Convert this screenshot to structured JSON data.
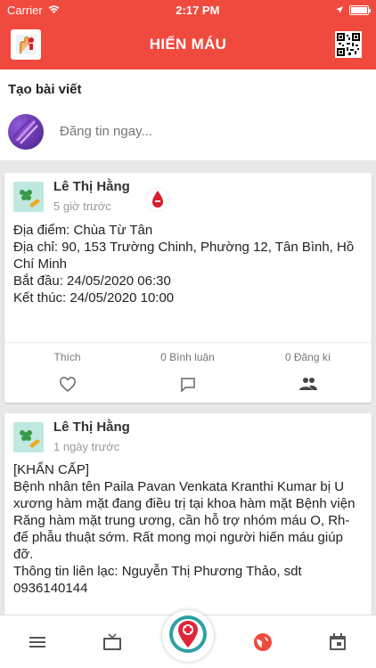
{
  "status_bar": {
    "carrier": "Carrier",
    "time": "2:17 PM"
  },
  "nav": {
    "title": "HIẾN MÁU",
    "left_icon": "blood-donor-icon",
    "right_icon": "qr-code-icon"
  },
  "create_post": {
    "title": "Tạo bài viết",
    "placeholder": "Đăng tin ngay..."
  },
  "posts": [
    {
      "author": "Lê Thị Hằng",
      "time": "5 giờ trước",
      "lines": [
        "Địa điểm: Chùa Từ Tân",
        "Địa chỉ: 90, 153 Trường Chinh, Phường 12, Tân Bình, Hồ Chí Minh",
        "Bắt đầu: 24/05/2020 06:30",
        "Kết thúc: 24/05/2020 10:00"
      ],
      "actions": {
        "like": "Thích",
        "comments": "0 Bình luận",
        "register": "0 Đăng kí"
      }
    },
    {
      "author": "Lê Thị Hằng",
      "time": "1 ngày trước",
      "lines": [
        "[KHẨN CẤP]",
        "Bệnh nhân tên Paila Pavan Venkata Kranthi Kumar bị U xương hàm mặt đang điều trị tại khoa hàm mặt Bệnh viện Răng hàm mặt trung ương, cần hỗ trợ nhóm máu O, Rh- để phẫu thuật sớm. Rất mong mọi người hiến máu giúp đỡ.",
        "Thông tin liên lạc: Nguyễn Thị Phương Thảo, sdt 0936140144"
      ]
    }
  ],
  "tabs": [
    {
      "icon": "menu-icon"
    },
    {
      "icon": "tv-icon"
    },
    {
      "icon": "blood-location-icon"
    },
    {
      "icon": "globe-icon",
      "active": true
    },
    {
      "icon": "calendar-icon"
    }
  ],
  "colors": {
    "brand": "#f04a3e",
    "blood": "#d8202c"
  }
}
